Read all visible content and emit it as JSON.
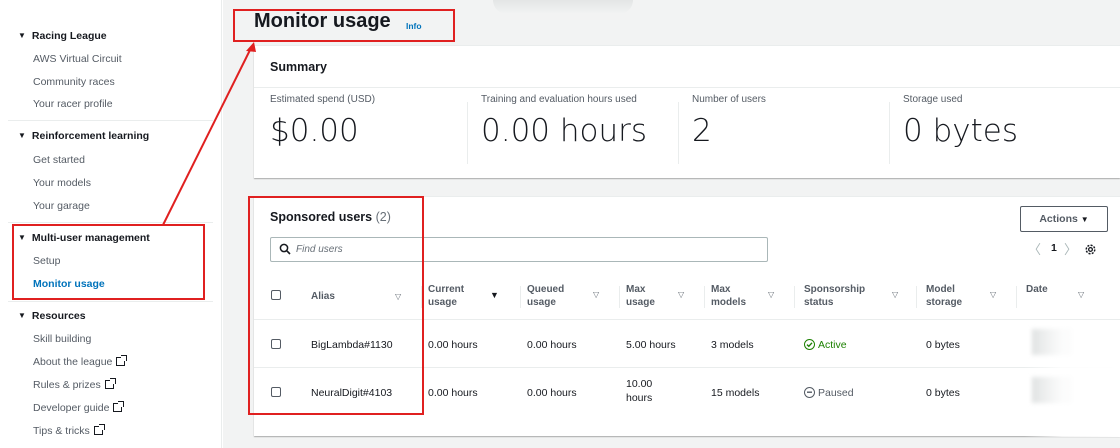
{
  "sidebar": {
    "sections": [
      {
        "title": "Racing League",
        "items": [
          "AWS Virtual Circuit",
          "Community races",
          "Your racer profile"
        ]
      },
      {
        "title": "Reinforcement learning",
        "items": [
          "Get started",
          "Your models",
          "Your garage"
        ]
      },
      {
        "title": "Multi-user management",
        "items": [
          "Setup",
          "Monitor usage"
        ]
      },
      {
        "title": "Resources",
        "items": [
          "Skill building",
          "About the league",
          "Rules & prizes",
          "Developer guide",
          "Tips & tricks"
        ]
      }
    ],
    "active_item": "Monitor usage"
  },
  "page": {
    "title": "Monitor usage",
    "info_link": "Info"
  },
  "summary": {
    "heading": "Summary",
    "metrics": [
      {
        "label": "Estimated spend (USD)",
        "value": "$0.00"
      },
      {
        "label": "Training and evaluation hours used",
        "value": "0.00 hours"
      },
      {
        "label": "Number of users",
        "value": "2"
      },
      {
        "label": "Storage used",
        "value": "0 bytes"
      }
    ]
  },
  "users_table": {
    "heading": "Sponsored users",
    "count": "(2)",
    "actions_label": "Actions",
    "search_placeholder": "Find users",
    "pagination": {
      "prev": "〈",
      "page": "1",
      "next": "〉"
    },
    "columns": {
      "alias": "Alias",
      "current_usage": [
        "Current",
        "usage"
      ],
      "queued_usage": [
        "Queued",
        "usage"
      ],
      "max_usage": [
        "Max",
        "usage"
      ],
      "max_models": [
        "Max",
        "models"
      ],
      "sponsorship_status": [
        "Sponsorship",
        "status"
      ],
      "model_storage": [
        "Model",
        "storage"
      ],
      "date": "Date"
    },
    "rows": [
      {
        "alias": "BigLambda#1130",
        "current_usage": "0.00 hours",
        "queued_usage": "0.00 hours",
        "max_usage_1": "5.00 hours",
        "max_usage_2": "",
        "max_models": "3 models",
        "status": "Active",
        "model_storage": "0 bytes"
      },
      {
        "alias": "NeuralDigit#4103",
        "current_usage": "0.00 hours",
        "queued_usage": "0.00 hours",
        "max_usage_1": "10.00",
        "max_usage_2": "hours",
        "max_models": "15 models",
        "status": "Paused",
        "model_storage": "0 bytes"
      }
    ]
  },
  "colors": {
    "link": "#0073bb",
    "active_status": "#1d8102",
    "annotation": "#e02020"
  }
}
